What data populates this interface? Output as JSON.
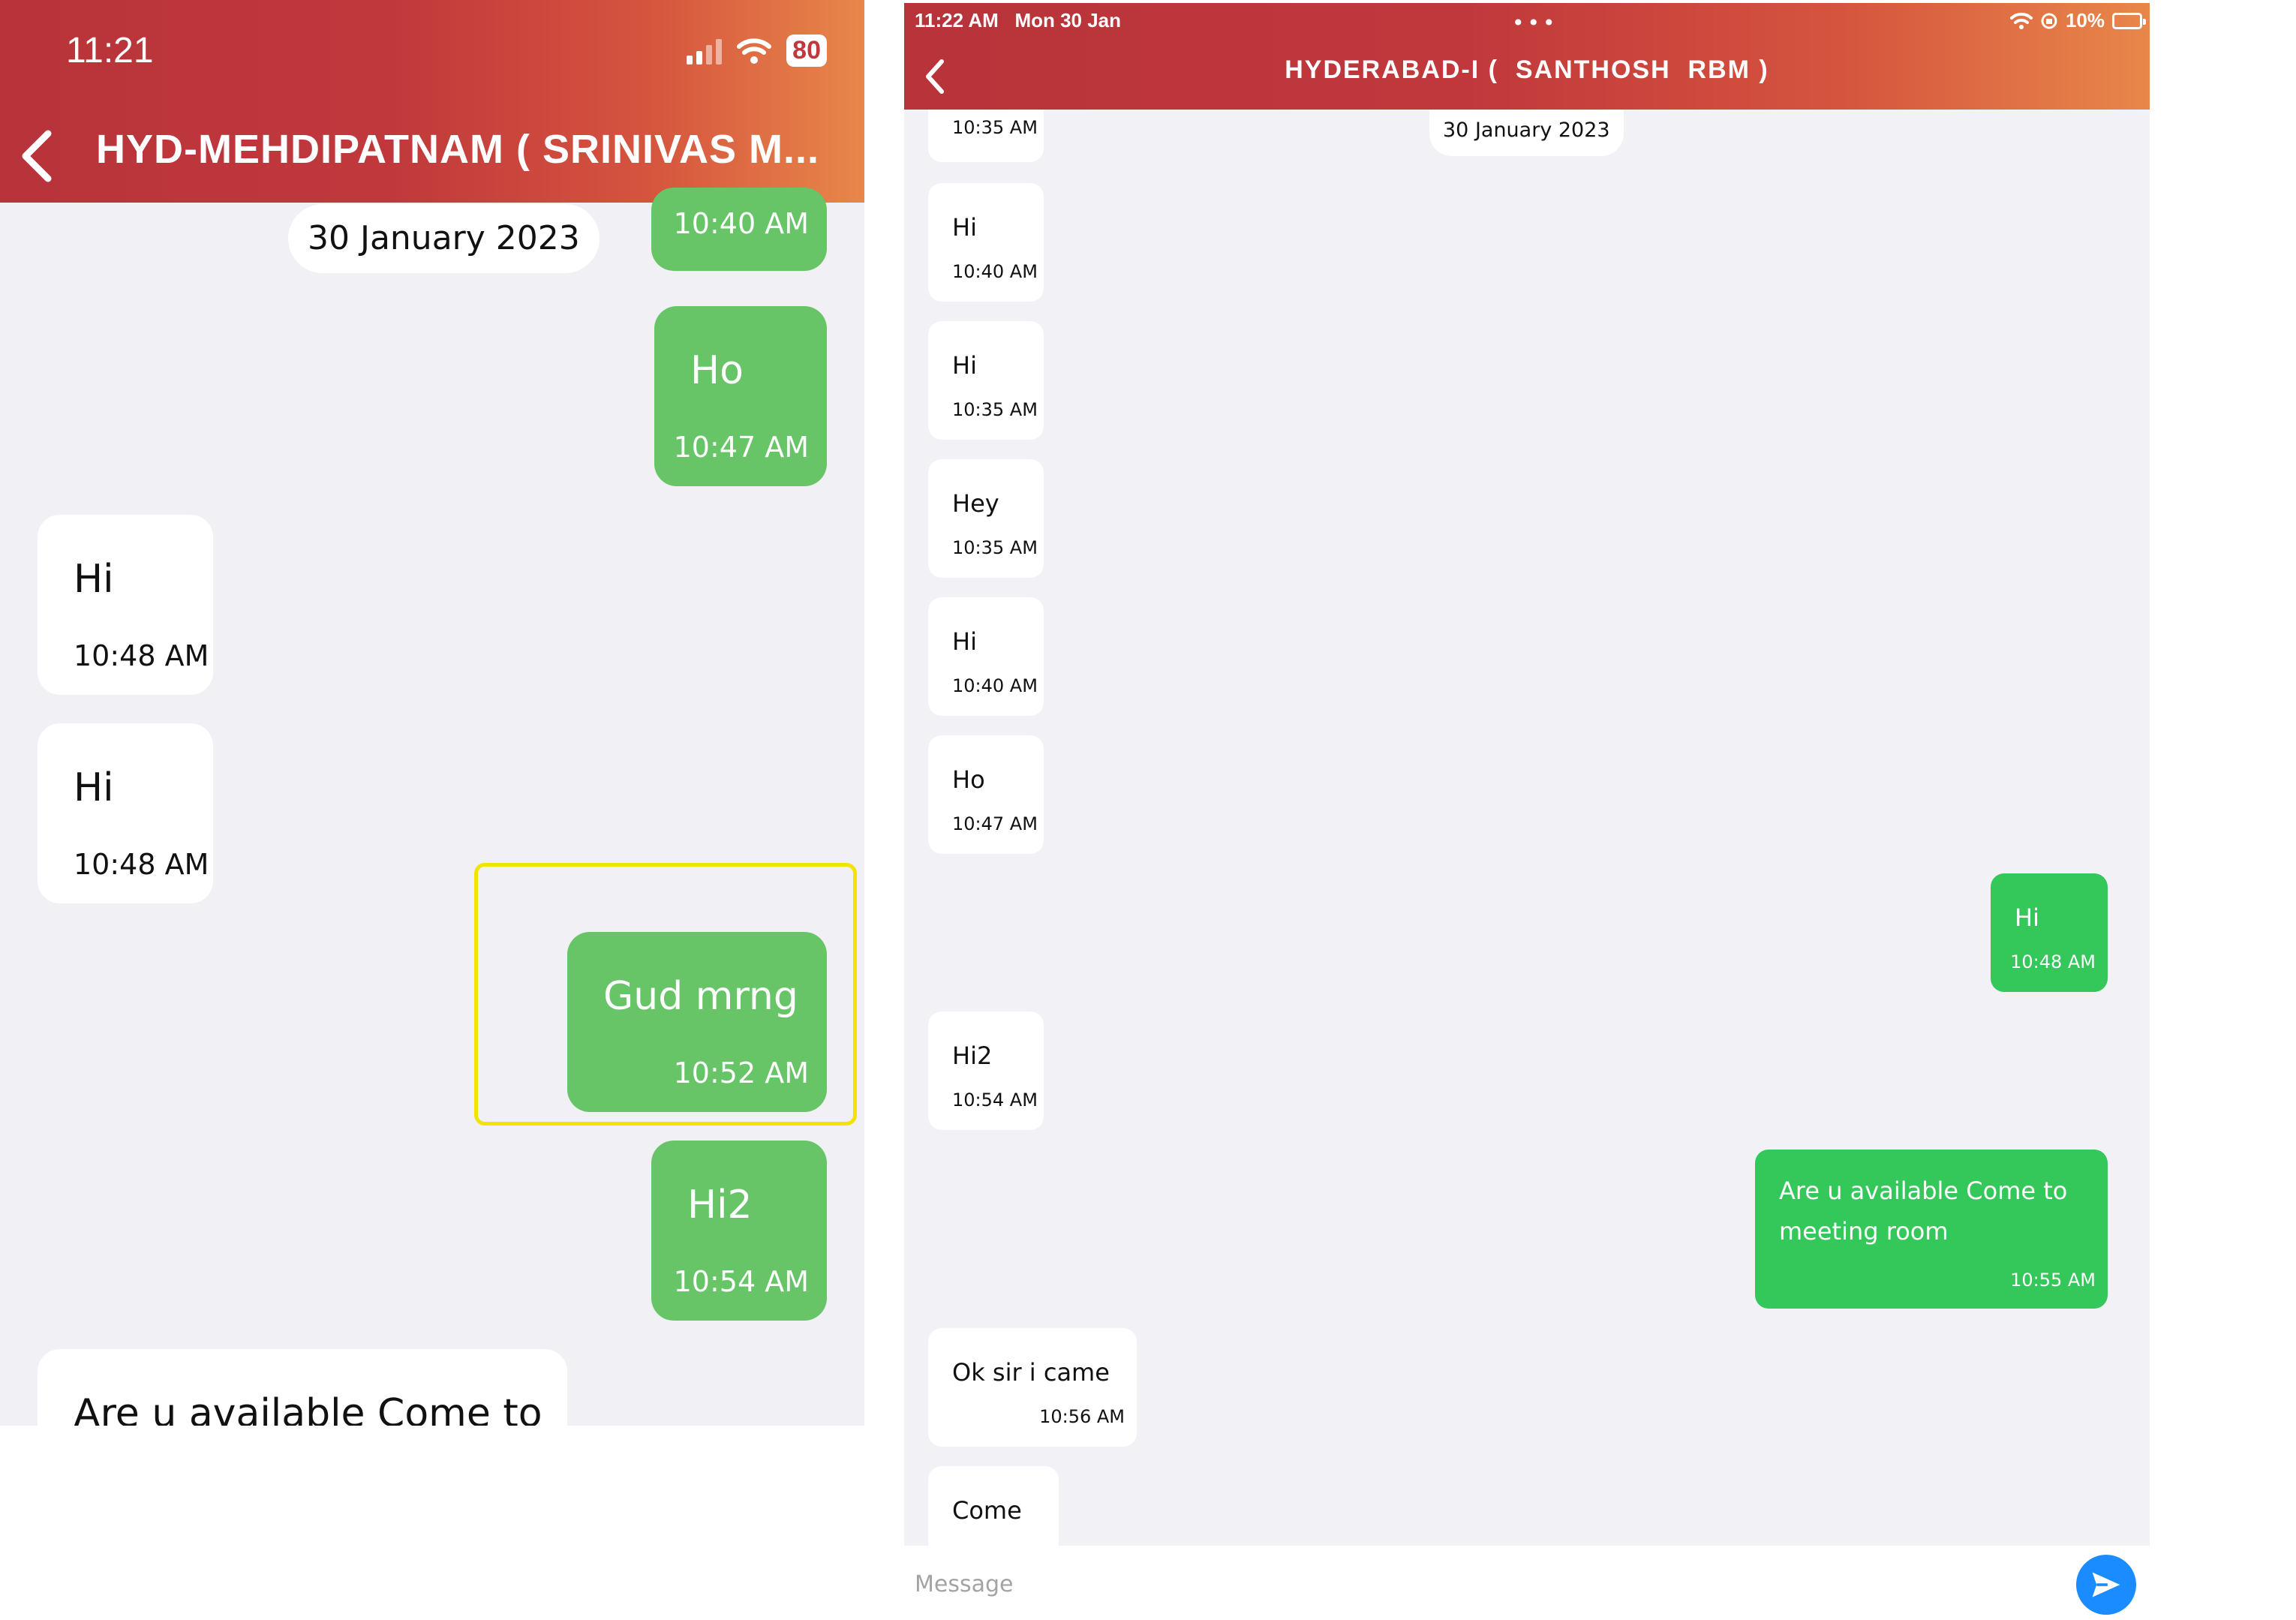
{
  "left": {
    "status": {
      "time": "11:21",
      "battery": "80"
    },
    "header": {
      "title": "HYD-MEHDIPATNAM ( SRINIVAS M..."
    },
    "date_chip": "30 January 2023",
    "messages": [
      {
        "dir": "out",
        "text": "",
        "time": "10:40 AM"
      },
      {
        "dir": "out",
        "text": "Ho",
        "time": "10:47 AM"
      },
      {
        "dir": "in",
        "text": "Hi",
        "time": "10:48 AM"
      },
      {
        "dir": "in",
        "text": "Hi",
        "time": "10:48 AM"
      },
      {
        "dir": "out",
        "text": "Gud mrng",
        "time": "10:52 AM"
      },
      {
        "dir": "out",
        "text": "Hi2",
        "time": "10:54 AM"
      },
      {
        "dir": "in",
        "text": "Are u available Come to",
        "time": ""
      }
    ]
  },
  "right": {
    "status": {
      "time": "11:22 AM",
      "date": "Mon 30 Jan",
      "battery": "10%"
    },
    "header": {
      "title": "HYDERABAD-I (  SANTHOSH  RBM )"
    },
    "date_chip": "30 January 2023",
    "messages": [
      {
        "dir": "in",
        "text": "",
        "time": "10:35 AM"
      },
      {
        "dir": "in",
        "text": "Hi",
        "time": "10:40 AM"
      },
      {
        "dir": "in",
        "text": "Hi",
        "time": "10:35 AM"
      },
      {
        "dir": "in",
        "text": "Hey",
        "time": "10:35 AM"
      },
      {
        "dir": "in",
        "text": "Hi",
        "time": "10:40 AM"
      },
      {
        "dir": "in",
        "text": "Ho",
        "time": "10:47 AM"
      },
      {
        "dir": "out",
        "text": "Hi",
        "time": "10:48 AM"
      },
      {
        "dir": "in",
        "text": "Hi2",
        "time": "10:54 AM"
      },
      {
        "dir": "out",
        "text": "Are u available Come to meeting room",
        "time": "10:55 AM"
      },
      {
        "dir": "in",
        "text": "Ok sir i came",
        "time": "10:56 AM"
      },
      {
        "dir": "in",
        "text": "Come",
        "time": ""
      }
    ],
    "composer": {
      "placeholder": "Message",
      "value": ""
    }
  },
  "colors": {
    "header_start": "#b8343a",
    "header_end": "#e8874a",
    "bubble_out_left": "#67c467",
    "bubble_out_right": "#34c759",
    "bubble_in": "#ffffff",
    "chat_bg": "#f1f0f5",
    "send_button": "#1a8cff",
    "highlight_border": "#f2e400"
  },
  "icons": [
    "back-chevron-icon",
    "signal-icon",
    "wifi-icon",
    "battery-icon",
    "orientation-lock-icon",
    "send-icon"
  ]
}
